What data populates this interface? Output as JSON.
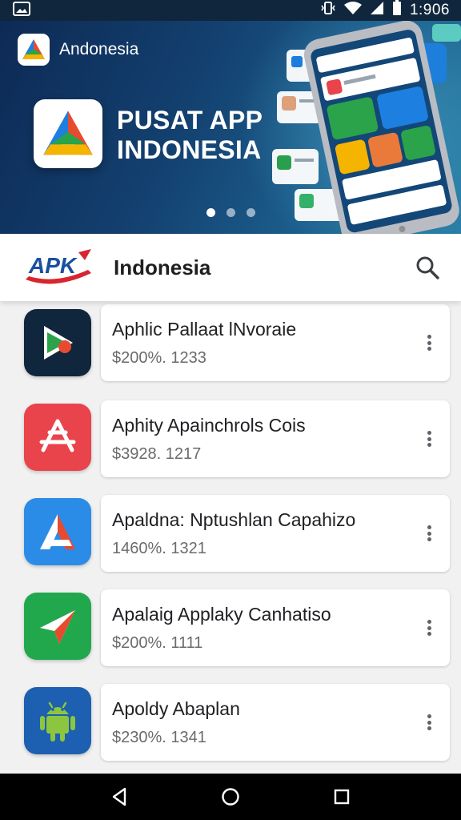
{
  "status_bar": {
    "time": "1:906",
    "icons": [
      "gallery-icon",
      "vibrate-icon",
      "wifi-icon",
      "signal-icon",
      "battery-icon"
    ]
  },
  "banner": {
    "brand_name": "Andonesia",
    "title_line1": "PUSAT APP",
    "title_line2": "INDONESIA",
    "slides": 3,
    "active_slide": 0
  },
  "header": {
    "logo_text": "APK",
    "title": "Indonesia"
  },
  "apps": [
    {
      "name": "Aphlic Pallaat lNvoraie",
      "meta": "$200%. 1233",
      "icon": "play-store-icon",
      "icon_bg": "#10263c"
    },
    {
      "name": "Aphity Apainchrols Cois",
      "meta": "$3928. 1217",
      "icon": "app-store-icon",
      "icon_bg": "#e9434b"
    },
    {
      "name": "Apaldna: Nptushlan Capahizo",
      "meta": "1460%. 1321",
      "icon": "letter-a-icon",
      "icon_bg": "#2b8ce8"
    },
    {
      "name": "Apalaig Applaky Canhatiso",
      "meta": "$200%. 1111",
      "icon": "paper-plane-icon",
      "icon_bg": "#21a84c"
    },
    {
      "name": "Apoldy Abaplan",
      "meta": "$230%. 1341",
      "icon": "android-icon",
      "icon_bg": "#1d5fb0"
    }
  ],
  "colors": {
    "status_bar": "#10263c",
    "banner_dark": "#0d2a55",
    "accent_red": "#d7262f",
    "nav_bar": "#000000"
  }
}
